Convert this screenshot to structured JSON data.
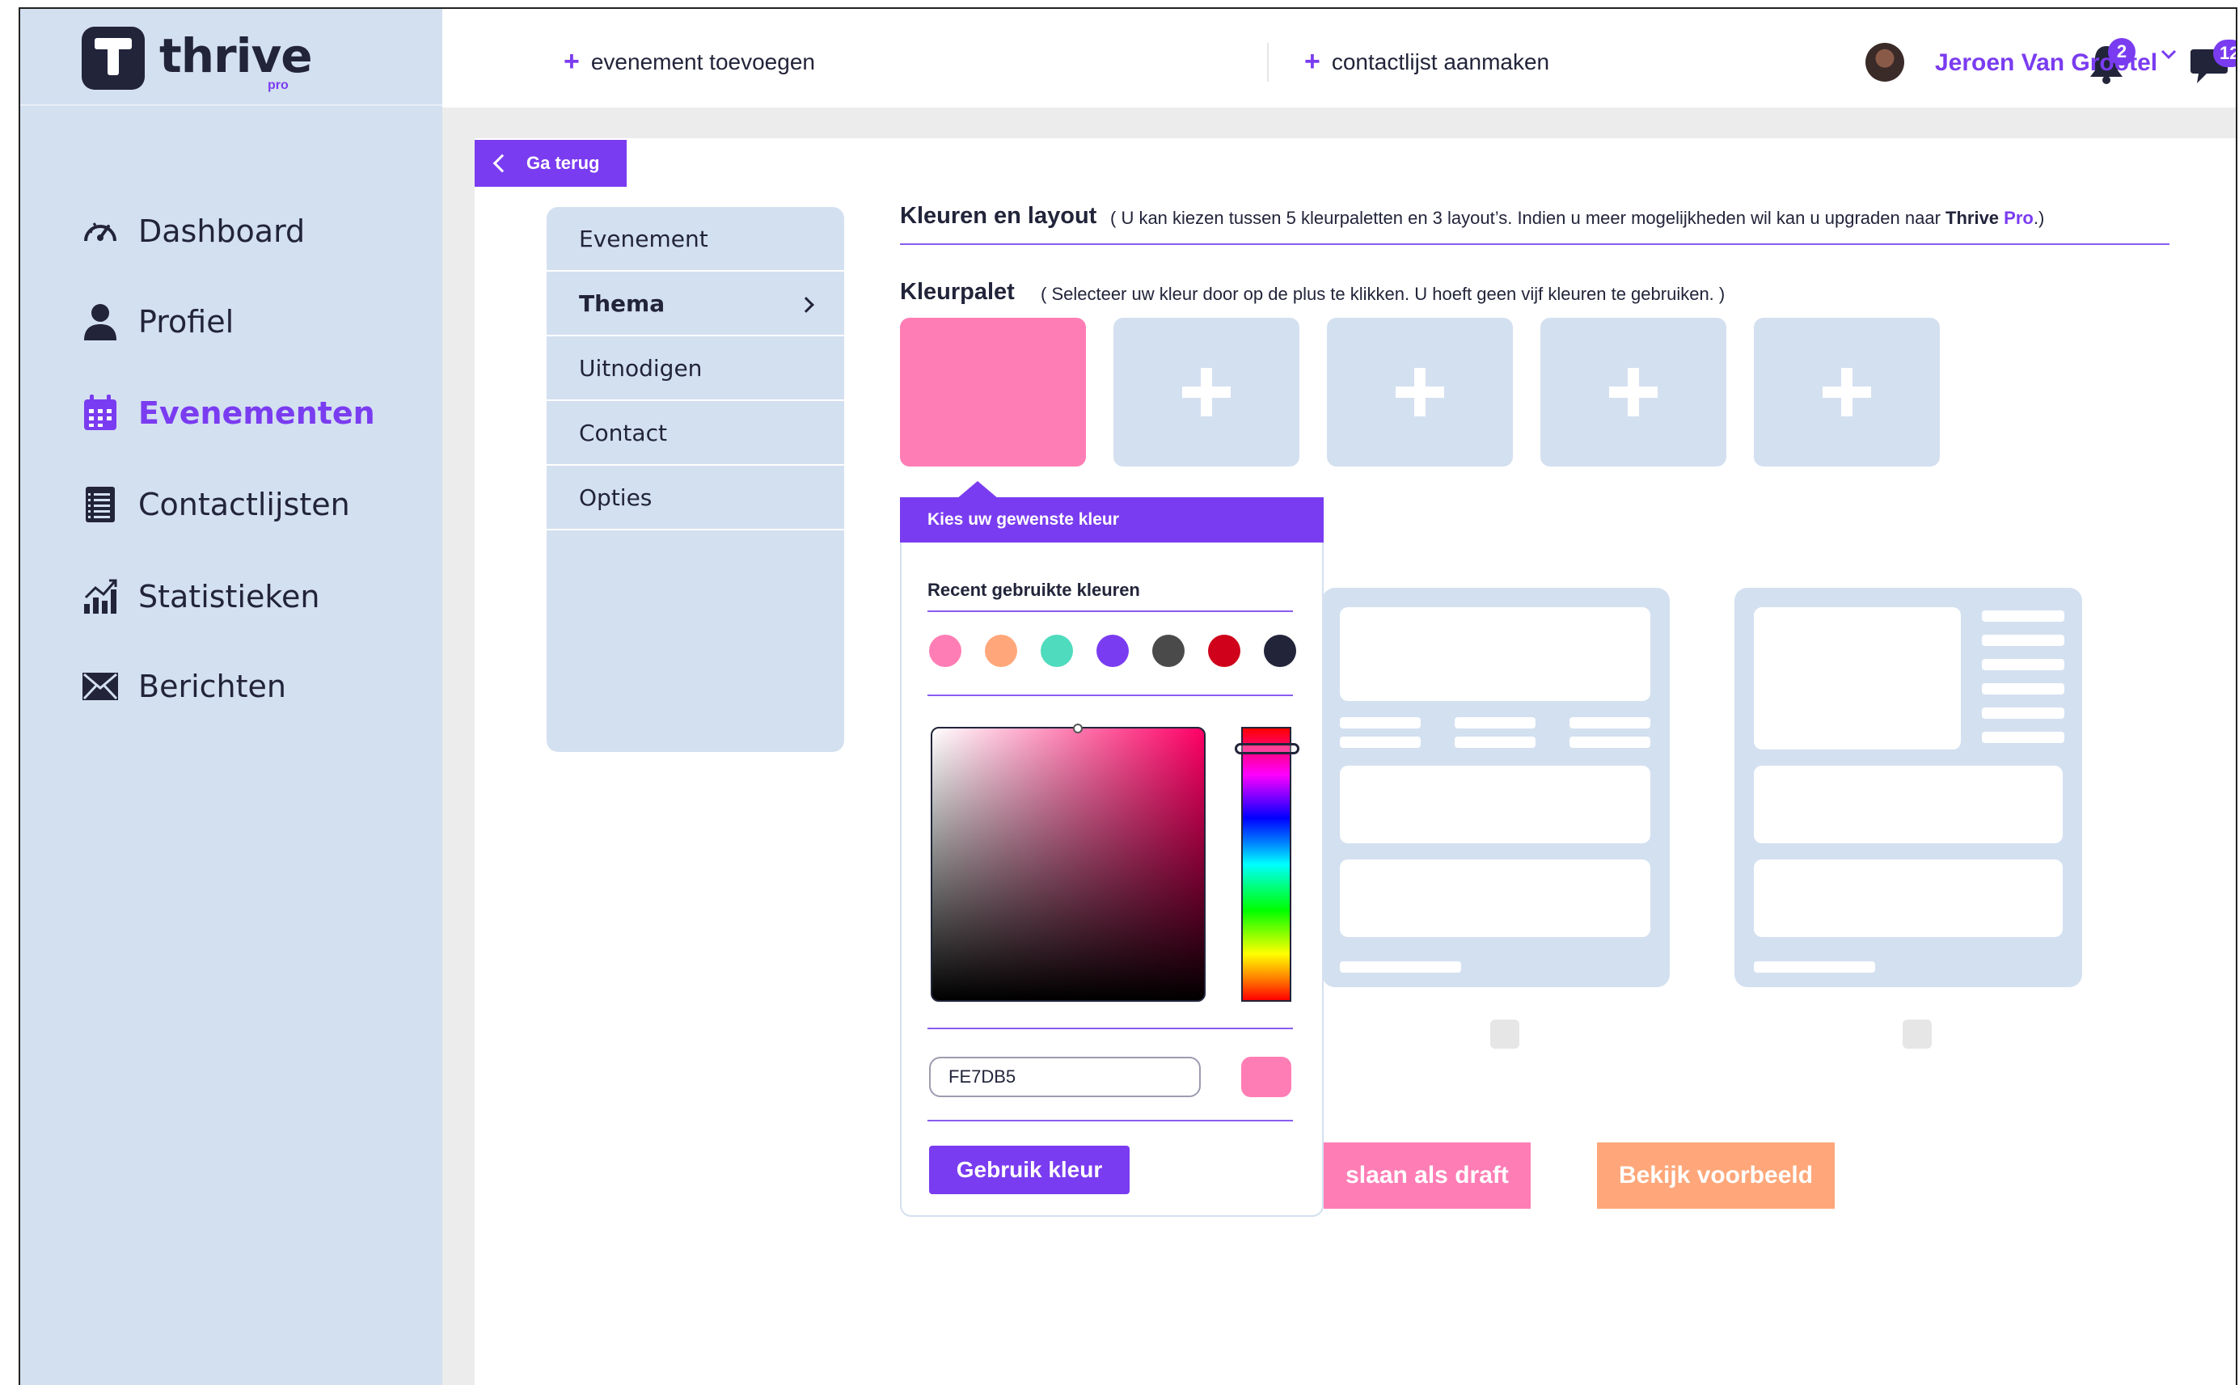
{
  "app": {
    "brand": "thrive",
    "brand_sub": "pro"
  },
  "sidebar": {
    "items": [
      {
        "label": "Dashboard",
        "icon": "gauge-icon"
      },
      {
        "label": "Profiel",
        "icon": "user-icon"
      },
      {
        "label": "Evenementen",
        "icon": "calendar-icon",
        "active": true
      },
      {
        "label": "Contactlijsten",
        "icon": "list-icon"
      },
      {
        "label": "Statistieken",
        "icon": "chart-icon"
      },
      {
        "label": "Berichten",
        "icon": "envelope-icon"
      }
    ]
  },
  "topbar": {
    "add_event": "evenement toevoegen",
    "add_contactlist": "contactlijst aanmaken",
    "notifications_count": "2",
    "messages_count": "12",
    "user_name": "Jeroen Van Grootel"
  },
  "back_button": "Ga terug",
  "submenu": {
    "items": [
      {
        "label": "Evenement"
      },
      {
        "label": "Thema",
        "active": true
      },
      {
        "label": "Uitnodigen"
      },
      {
        "label": "Contact"
      },
      {
        "label": "Opties"
      }
    ]
  },
  "content": {
    "colors_title": "Kleuren en layout",
    "colors_sub_prefix": "( U kan kiezen tussen 5 kleurpaletten en 3 layout’s. Indien u meer mogelijkheden wil kan u upgraden naar ",
    "colors_sub_brand": "Thrive",
    "colors_sub_pro": "Pro",
    "colors_sub_suffix": ".)",
    "palette_title": "Kleurpalet",
    "palette_sub": "( Selecteer uw kleur door op de plus te klikken. U hoeft geen vijf kleuren te gebruiken. )",
    "selected_color": "#ff7db5",
    "save_draft": "slaan als draft",
    "preview": "Bekijk voorbeeld"
  },
  "picker": {
    "title": "Kies uw gewenste kleur",
    "recent_label": "Recent gebruikte kleuren",
    "recent_colors": [
      "#ff7db5",
      "#ffa77a",
      "#4fdbbe",
      "#7a3cf0",
      "#4a4a4a",
      "#d0021b",
      "#22243a"
    ],
    "hex_value": "FE7DB5",
    "use_button": "Gebruik kleur"
  },
  "colors": {
    "accent": "#7a3cf0",
    "sidebar_bg": "#d3e0f0",
    "pink": "#ff7db5",
    "orange": "#ffa77a",
    "dark": "#22243a"
  }
}
